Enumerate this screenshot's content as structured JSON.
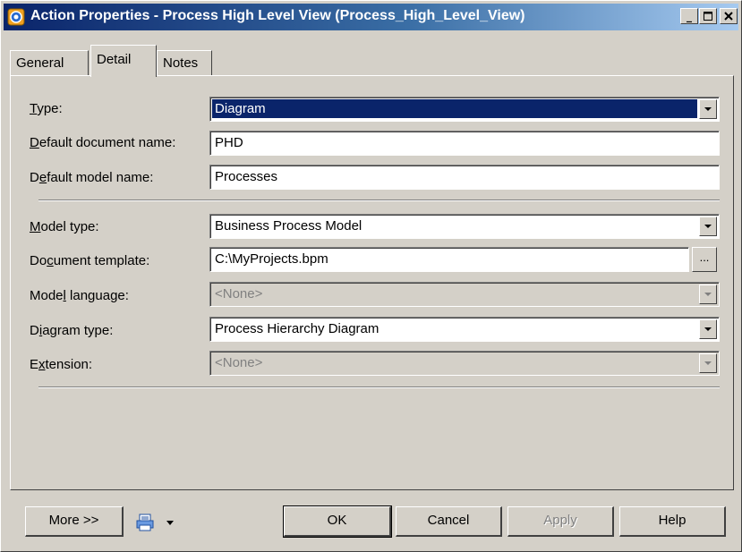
{
  "window": {
    "title": "Action Properties - Process High Level View (Process_High_Level_View)"
  },
  "tabs": [
    {
      "label": "General",
      "active": false
    },
    {
      "label": "Detail",
      "active": true
    },
    {
      "label": "Notes",
      "active": false
    }
  ],
  "fields": {
    "type": {
      "label_u": "T",
      "label_rest": "ype:",
      "value": "Diagram"
    },
    "default_document_name": {
      "label_u": "D",
      "label_rest": "efault document name:",
      "value": "PHD"
    },
    "default_model_name": {
      "label_pre": "D",
      "label_u": "e",
      "label_rest": "fault model name:",
      "value": "Processes"
    },
    "model_type": {
      "label_u": "M",
      "label_rest": "odel type:",
      "value": "Business Process Model"
    },
    "document_template": {
      "label_pre": "Do",
      "label_u": "c",
      "label_rest": "ument template:",
      "value": "C:\\MyProjects.bpm"
    },
    "model_language": {
      "label_pre": "Mode",
      "label_u": "l",
      "label_rest": " language:",
      "value": "<None>"
    },
    "diagram_type": {
      "label_pre": "D",
      "label_u": "i",
      "label_rest": "agram type:",
      "value": "Process Hierarchy Diagram"
    },
    "extension": {
      "label_pre": "E",
      "label_u": "x",
      "label_rest": "tension:",
      "value": "<None>"
    }
  },
  "buttons": {
    "more": "More >>",
    "ok": "OK",
    "cancel": "Cancel",
    "apply": "Apply",
    "help": "Help",
    "ellipsis": "..."
  },
  "colors": {
    "titlebar_start": "#0a246a",
    "selection": "#0a246a",
    "face": "#d4d0c8"
  }
}
